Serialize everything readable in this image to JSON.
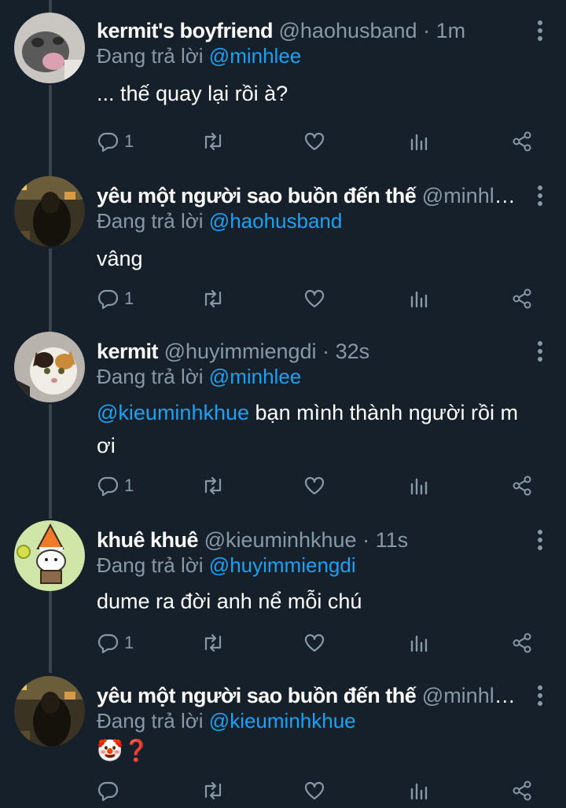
{
  "tweets": [
    {
      "name": "kermit's boyfriend",
      "handle": "@haohusband",
      "time": "1m",
      "replying_prefix": "Đang trả lời",
      "replying_to": "@minhlee",
      "body_mention": "",
      "body_text": "... thế quay lại rồi à?",
      "reply_count": "1",
      "avatar": "gray-cat-avatar"
    },
    {
      "name": "yêu một người sao buồn đến thế",
      "handle": "@minhlee",
      "time": "",
      "replying_prefix": "Đang trả lời",
      "replying_to": "@haohusband",
      "body_mention": "",
      "body_text": "vâng",
      "reply_count": "1",
      "avatar": "dark-street-avatar"
    },
    {
      "name": "kermit",
      "handle": "@huyimmiengdi",
      "time": "32s",
      "replying_prefix": "Đang trả lời",
      "replying_to": "@minhlee",
      "body_mention": "@kieuminhkhue",
      "body_text": "bạn mình thành người rồi m ơi",
      "reply_count": "1",
      "avatar": "calico-cat-avatar"
    },
    {
      "name": "khuê khuê",
      "handle": "@kieuminhkhue",
      "time": "11s",
      "replying_prefix": "Đang trả lời",
      "replying_to": "@huyimmiengdi",
      "body_mention": "",
      "body_text": "dume ra đời anh nể mỗi chú",
      "reply_count": "1",
      "avatar": "cartoon-dog-avatar"
    },
    {
      "name": "yêu một người sao buồn đến thế",
      "handle": "@minhlee",
      "time": "",
      "replying_prefix": "Đang trả lời",
      "replying_to": "@kieuminhkhue",
      "body_mention": "",
      "body_text": "🤡❓",
      "reply_count": "",
      "avatar": "dark-street-avatar"
    }
  ],
  "colors": {
    "background": "#15202b",
    "text": "#ffffff",
    "muted": "#8899a6",
    "link": "#1da1f2",
    "thread_line": "#38444d"
  },
  "icons": {
    "reply": "comment-bubble-icon",
    "retweet": "retweet-icon",
    "like": "heart-icon",
    "analytics": "bar-chart-icon",
    "share": "share-icon",
    "more": "vertical-dots-icon"
  }
}
